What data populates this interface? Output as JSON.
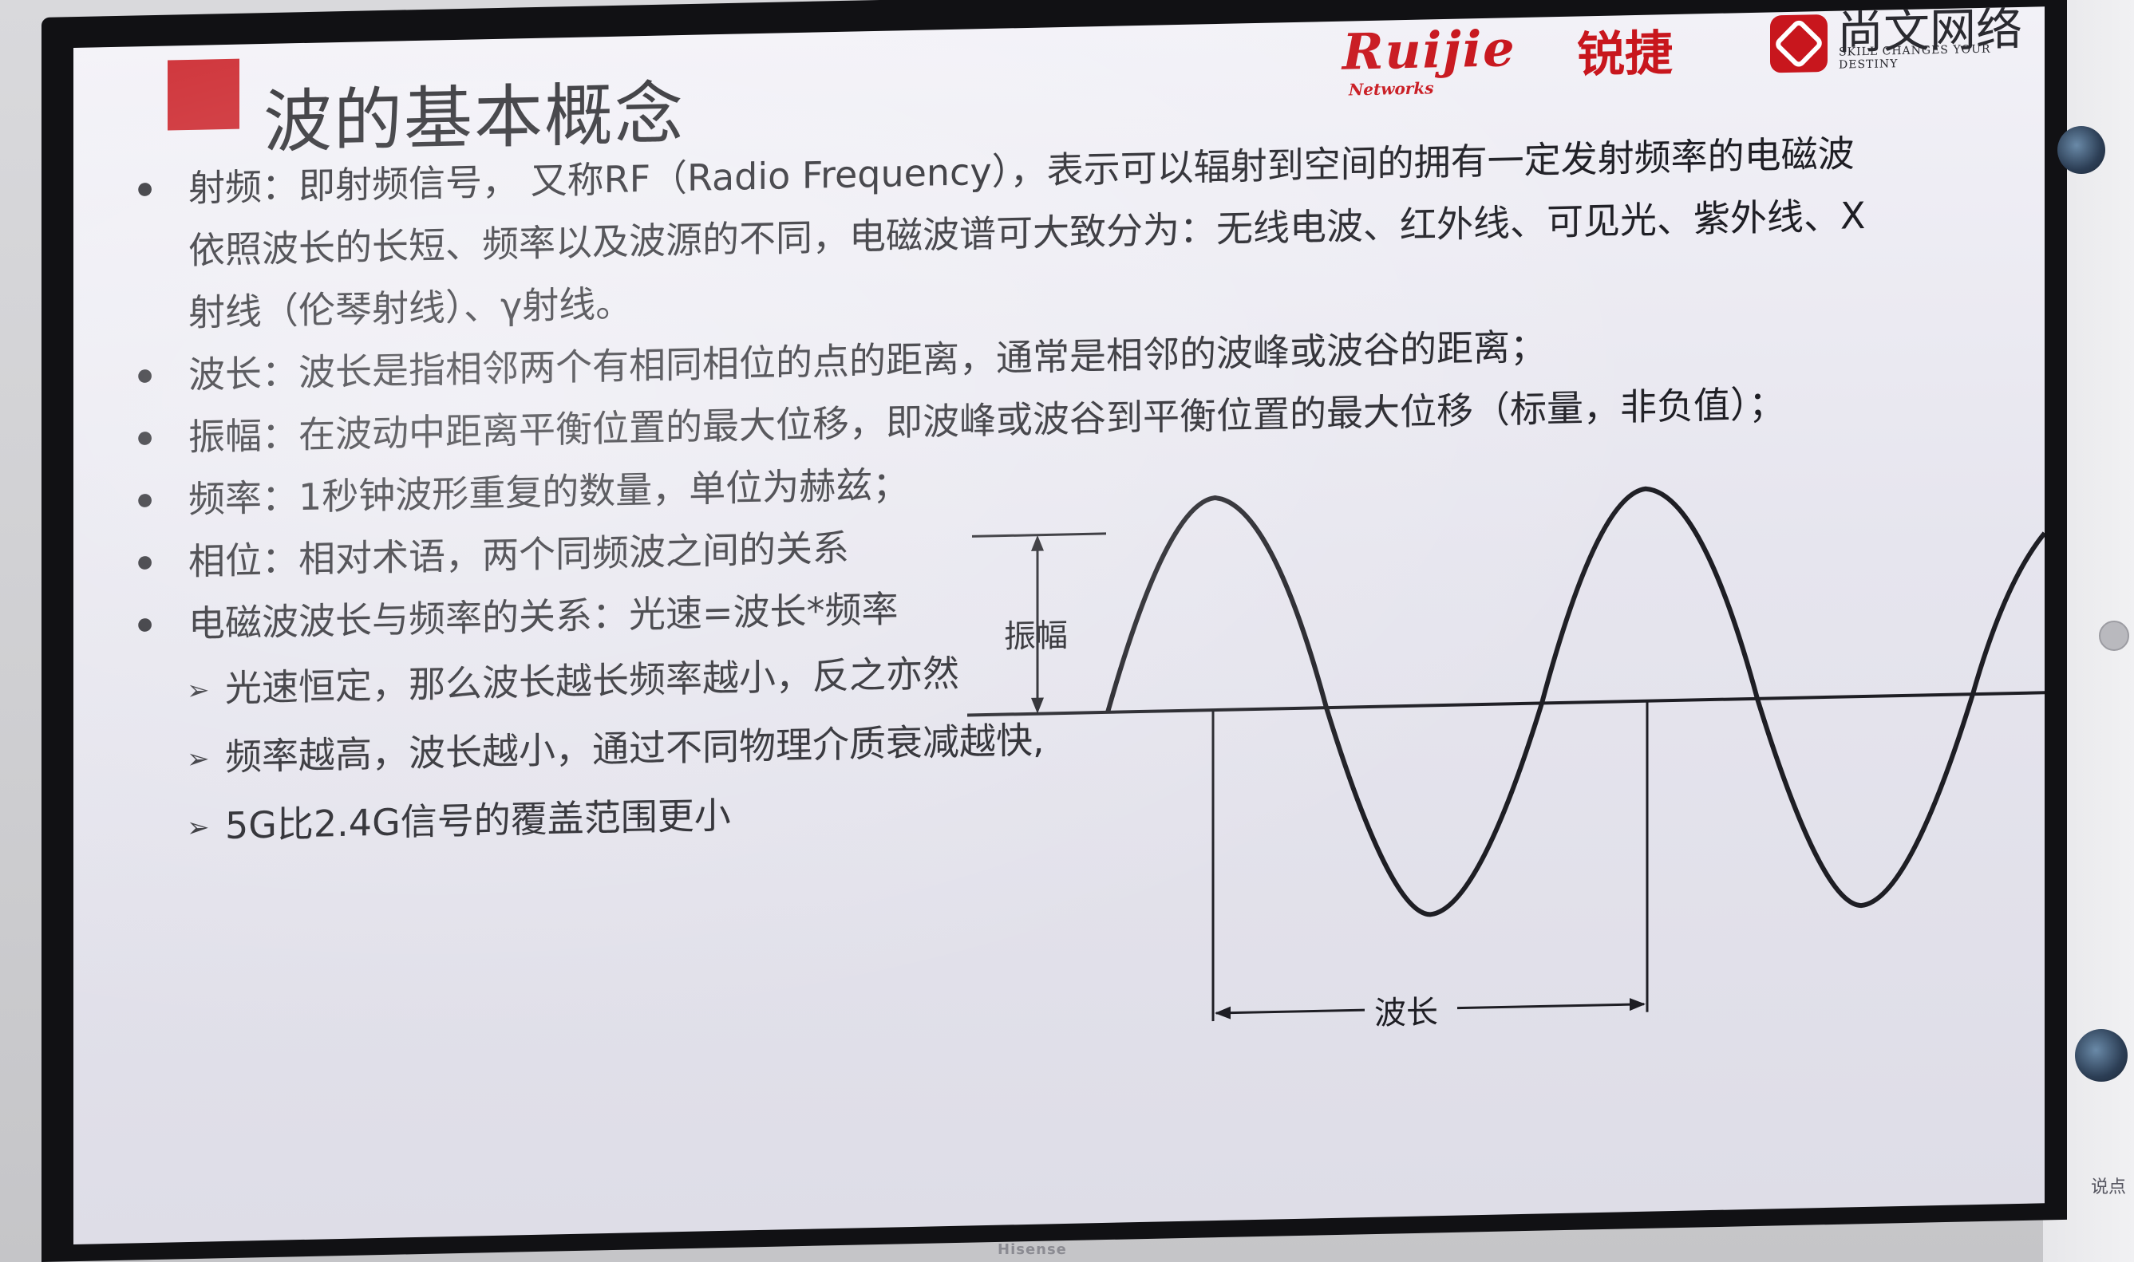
{
  "slide": {
    "title": "波的基本概念",
    "logo_ruijie": "Ruijie",
    "logo_ruijie_cn": "锐捷",
    "logo_networks": "Networks",
    "logo_shangwen": "尚文网络",
    "logo_shangwen_slogan": "SKILL CHANGES YOUR DESTINY",
    "bullets": [
      {
        "line1": "射频：即射频信号，  又称RF（Radio Frequency），表示可以辐射到空间的拥有一定发射频率的电磁波",
        "line2": "依照波长的长短、频率以及波源的不同，电磁波谱可大致分为：无线电波、红外线、可见光、紫外线、X",
        "line3": "射线（伦琴射线）、γ射线。"
      },
      {
        "line1": "波长：波长是指相邻两个有相同相位的点的距离，通常是相邻的波峰或波谷的距离；"
      },
      {
        "line1": "振幅：在波动中距离平衡位置的最大位移，即波峰或波谷到平衡位置的最大位移（标量，非负值）；"
      },
      {
        "line1": "频率：1秒钟波形重复的数量，单位为赫兹；"
      },
      {
        "line1": "相位：相对术语，两个同频波之间的关系"
      },
      {
        "line1": "电磁波波长与频率的关系：光速=波长*频率"
      }
    ],
    "subs": [
      "光速恒定，那么波长越长频率越小，反之亦然",
      "频率越高，波长越小，通过不同物理介质衰减越快,",
      "5G比2.4G信号的覆盖范围更小"
    ],
    "diagram": {
      "amplitude_label": "振幅",
      "wavelength_label": "波长"
    }
  },
  "tv_brand": "Hisense",
  "side_text": "说点",
  "colors": {
    "accent_red": "#c8161d",
    "text": "#1e1e24"
  }
}
